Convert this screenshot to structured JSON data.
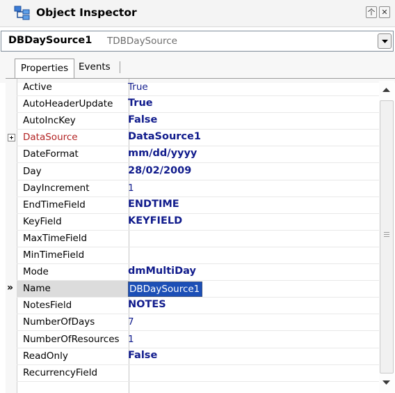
{
  "window": {
    "title": "Object Inspector",
    "pin_glyph": "个",
    "close_glyph": "✕"
  },
  "component_selector": {
    "name": "DBDaySource1",
    "type": "TDBDaySource"
  },
  "tabs": [
    {
      "label": "Properties",
      "active": true
    },
    {
      "label": "Events",
      "active": false
    }
  ],
  "properties": [
    {
      "name": "Active",
      "value": "True"
    },
    {
      "name": "AutoHeaderUpdate",
      "value": "True"
    },
    {
      "name": "AutoIncKey",
      "value": "False"
    },
    {
      "name": "DataSource",
      "value": "DataSource1"
    },
    {
      "name": "DateFormat",
      "value": "mm/dd/yyyy"
    },
    {
      "name": "Day",
      "value": "28/02/2009"
    },
    {
      "name": "DayIncrement",
      "value": "1"
    },
    {
      "name": "EndTimeField",
      "value": "ENDTIME"
    },
    {
      "name": "KeyField",
      "value": "KEYFIELD"
    },
    {
      "name": "MaxTimeField",
      "value": ""
    },
    {
      "name": "MinTimeField",
      "value": ""
    },
    {
      "name": "Mode",
      "value": "dmMultiDay"
    },
    {
      "name": "Name",
      "value": "DBDaySource1"
    },
    {
      "name": "NotesField",
      "value": "NOTES"
    },
    {
      "name": "NumberOfDays",
      "value": "7"
    },
    {
      "name": "NumberOfResources",
      "value": "1"
    },
    {
      "name": "ReadOnly",
      "value": "False"
    },
    {
      "name": "RecurrencyField",
      "value": ""
    }
  ],
  "selected_marker": "»",
  "colors": {
    "value_text": "#101b8c",
    "reference_property": "#b22222",
    "selection": "#1c4fb6"
  }
}
